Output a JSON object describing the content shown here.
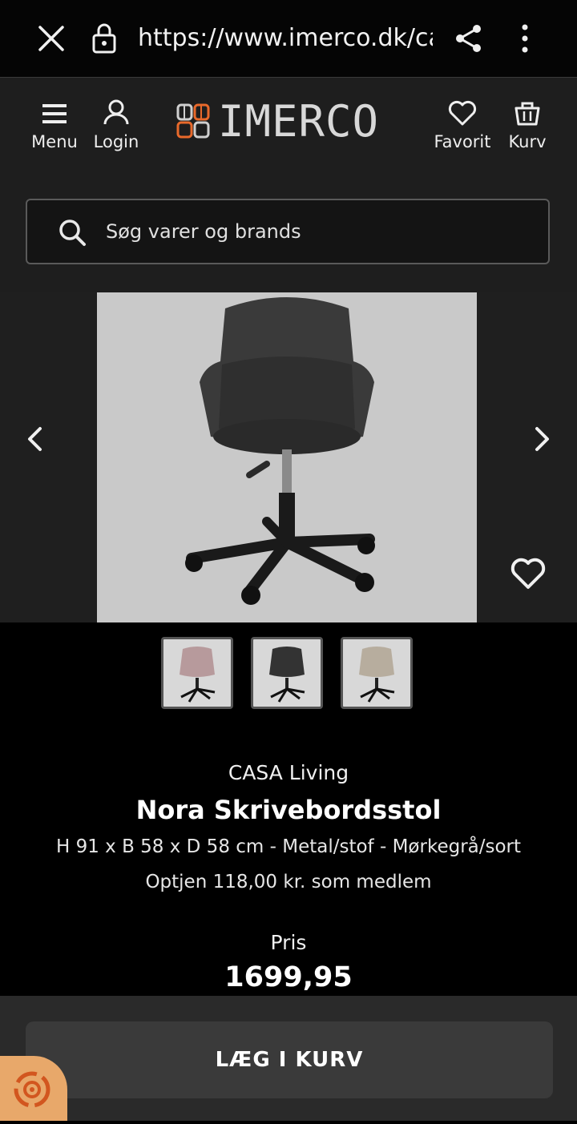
{
  "browser": {
    "url": "https://www.imerco.dk/ca",
    "icons": [
      "close-icon",
      "lock-icon",
      "share-icon",
      "more-icon"
    ]
  },
  "header": {
    "menu_label": "Menu",
    "login_label": "Login",
    "logo_text": "IMERCO",
    "favorit_label": "Favorit",
    "kurv_label": "Kurv",
    "search_placeholder": "Søg varer og brands"
  },
  "gallery": {
    "prev_icon": "chevron-left-icon",
    "next_icon": "chevron-right-icon",
    "favorite_icon": "heart-icon",
    "thumbnails": [
      "rose",
      "dark-grey",
      "beige"
    ]
  },
  "product": {
    "brand": "CASA Living",
    "name": "Nora Skrivebordsstol",
    "description": "H 91 x B 58 x D 58 cm - Metal/stof - Mørkegrå/sort",
    "member_bonus": "Optjen 118,00 kr. som medlem",
    "price_label": "Pris",
    "price_value": "1699,95"
  },
  "cta": {
    "add_to_cart_label": "LÆG I KURV"
  },
  "colors": {
    "logo_orange": "#e8692b",
    "fab": "#e8a86a"
  }
}
